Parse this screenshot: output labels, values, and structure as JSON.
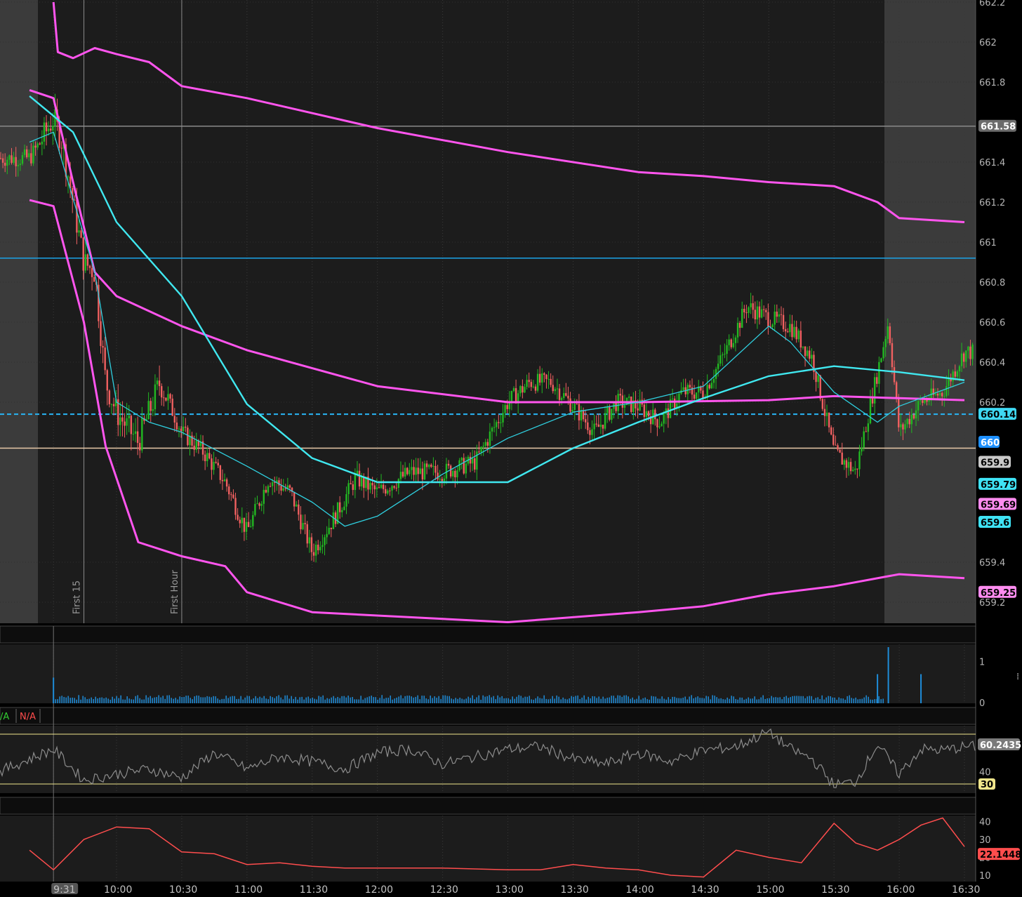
{
  "chart_data": [
    {
      "type": "candlestick",
      "ylim": [
        659.15,
        662.2
      ],
      "y_ticks": [
        "662.2",
        "662",
        "661.8",
        "661.4",
        "661.2",
        "661",
        "660.8",
        "660.6",
        "660.4",
        "660.2",
        "659.4",
        "659.2"
      ],
      "x_ticks": [
        "9:31",
        "10:00",
        "10:30",
        "11:00",
        "11:30",
        "12:00",
        "12:30",
        "13:00",
        "13:30",
        "14:00",
        "14:30",
        "15:00",
        "15:30",
        "16:00",
        "16:30"
      ],
      "marker_lines": [
        {
          "name": "First 15",
          "time": "9:45"
        },
        {
          "name": "First Hour",
          "time": "10:30"
        }
      ],
      "price_badges": [
        {
          "label": "661.58",
          "value": 661.58,
          "bg": "#6b6b6b",
          "fg": "#ffffff"
        },
        {
          "label": "660.14",
          "value": 660.14,
          "bg": "#3fd8f2",
          "fg": "#000000"
        },
        {
          "label": "660",
          "value": 660.0,
          "bg": "#1e90ff",
          "fg": "#ffffff"
        },
        {
          "label": "659.9",
          "value": 659.9,
          "bg": "#c9c9c9",
          "fg": "#000000"
        },
        {
          "label": "659.79",
          "value": 659.79,
          "bg": "#3fe3f5",
          "fg": "#000000"
        },
        {
          "label": "659.69",
          "value": 659.69,
          "bg": "#ff8cf0",
          "fg": "#000000"
        },
        {
          "label": "659.6",
          "value": 659.6,
          "bg": "#3fe3f5",
          "fg": "#000000"
        },
        {
          "label": "659.25",
          "value": 659.25,
          "bg": "#ff8cf0",
          "fg": "#000000"
        }
      ],
      "horizontal_levels": [
        {
          "value": 661.58,
          "color": "#8a8a8a",
          "style": "solid"
        },
        {
          "value": 660.92,
          "color": "#1aa3e8",
          "style": "solid"
        },
        {
          "value": 660.14,
          "color": "#29b6f6",
          "style": "dashed"
        },
        {
          "value": 659.97,
          "color": "#e8c9a8",
          "style": "solid"
        }
      ],
      "series": [
        {
          "role": "vwap_upper_band",
          "color": "#ff55ee",
          "points": [
            [
              "9:31",
              662.2
            ],
            [
              "9:33",
              661.95
            ],
            [
              "9:40",
              661.92
            ],
            [
              "9:50",
              661.97
            ],
            [
              "10:00",
              661.94
            ],
            [
              "10:15",
              661.9
            ],
            [
              "10:30",
              661.78
            ],
            [
              "11:00",
              661.72
            ],
            [
              "12:00",
              661.57
            ],
            [
              "13:00",
              661.45
            ],
            [
              "14:00",
              661.35
            ],
            [
              "14:30",
              661.33
            ],
            [
              "15:00",
              661.3
            ],
            [
              "15:30",
              661.28
            ],
            [
              "15:50",
              661.2
            ],
            [
              "16:00",
              661.12
            ],
            [
              "16:30",
              661.1
            ]
          ]
        },
        {
          "role": "vwap",
          "color": "#ff55ee",
          "points": [
            [
              "9:20",
              661.76
            ],
            [
              "9:31",
              661.72
            ],
            [
              "9:40",
              661.3
            ],
            [
              "9:50",
              660.85
            ],
            [
              "10:00",
              660.73
            ],
            [
              "10:30",
              660.58
            ],
            [
              "11:00",
              660.46
            ],
            [
              "12:00",
              660.28
            ],
            [
              "13:00",
              660.2
            ],
            [
              "14:00",
              660.2
            ],
            [
              "15:00",
              660.21
            ],
            [
              "15:30",
              660.23
            ],
            [
              "16:00",
              660.22
            ],
            [
              "16:30",
              660.21
            ]
          ]
        },
        {
          "role": "vwap_lower_band",
          "color": "#ff55ee",
          "points": [
            [
              "9:20",
              661.21
            ],
            [
              "9:31",
              661.18
            ],
            [
              "9:45",
              660.6
            ],
            [
              "9:55",
              659.98
            ],
            [
              "10:10",
              659.5
            ],
            [
              "10:30",
              659.43
            ],
            [
              "10:50",
              659.38
            ],
            [
              "11:00",
              659.25
            ],
            [
              "11:30",
              659.15
            ],
            [
              "13:00",
              659.1
            ],
            [
              "14:00",
              659.15
            ],
            [
              "14:30",
              659.18
            ],
            [
              "15:00",
              659.24
            ],
            [
              "15:30",
              659.28
            ],
            [
              "16:00",
              659.34
            ],
            [
              "16:30",
              659.32
            ]
          ]
        },
        {
          "role": "ma_slow",
          "color": "#40e8f0",
          "points": [
            [
              "9:20",
              661.73
            ],
            [
              "9:40",
              661.55
            ],
            [
              "10:00",
              661.1
            ],
            [
              "10:30",
              660.73
            ],
            [
              "11:00",
              660.19
            ],
            [
              "11:30",
              659.92
            ],
            [
              "12:00",
              659.8
            ],
            [
              "12:30",
              659.8
            ],
            [
              "13:00",
              659.8
            ],
            [
              "13:30",
              659.97
            ],
            [
              "14:00",
              660.1
            ],
            [
              "14:30",
              660.22
            ],
            [
              "15:00",
              660.33
            ],
            [
              "15:30",
              660.38
            ],
            [
              "16:00",
              660.35
            ],
            [
              "16:30",
              660.31
            ]
          ]
        },
        {
          "role": "ma_fast",
          "color": "#2fd0e0",
          "points": [
            [
              "9:20",
              661.5
            ],
            [
              "9:31",
              661.55
            ],
            [
              "9:50",
              660.85
            ],
            [
              "10:00",
              660.2
            ],
            [
              "10:15",
              660.1
            ],
            [
              "10:30",
              660.05
            ],
            [
              "11:00",
              659.88
            ],
            [
              "11:30",
              659.7
            ],
            [
              "11:45",
              659.58
            ],
            [
              "12:00",
              659.63
            ],
            [
              "12:30",
              659.84
            ],
            [
              "13:00",
              660.02
            ],
            [
              "13:30",
              660.15
            ],
            [
              "14:00",
              660.2
            ],
            [
              "14:30",
              660.28
            ],
            [
              "15:00",
              660.58
            ],
            [
              "15:10",
              660.5
            ],
            [
              "15:30",
              660.25
            ],
            [
              "15:50",
              660.1
            ],
            [
              "16:00",
              660.18
            ],
            [
              "16:30",
              660.3
            ]
          ]
        },
        {
          "role": "price_path",
          "color": "#2bb82b",
          "points": [
            [
              "9:20",
              661.42
            ],
            [
              "9:25",
              661.5
            ],
            [
              "9:31",
              661.62
            ],
            [
              "9:35",
              661.5
            ],
            [
              "9:40",
              661.2
            ],
            [
              "9:45",
              660.9
            ],
            [
              "9:50",
              660.85
            ],
            [
              "9:55",
              660.3
            ],
            [
              "10:00",
              660.15
            ],
            [
              "10:10",
              660.0
            ],
            [
              "10:20",
              660.3
            ],
            [
              "10:30",
              660.05
            ],
            [
              "10:40",
              659.95
            ],
            [
              "10:50",
              659.8
            ],
            [
              "11:00",
              659.55
            ],
            [
              "11:10",
              659.82
            ],
            [
              "11:20",
              659.75
            ],
            [
              "11:30",
              659.45
            ],
            [
              "11:40",
              659.62
            ],
            [
              "11:50",
              659.82
            ],
            [
              "12:00",
              659.75
            ],
            [
              "12:15",
              659.85
            ],
            [
              "12:30",
              659.85
            ],
            [
              "12:45",
              659.9
            ],
            [
              "13:00",
              660.2
            ],
            [
              "13:10",
              660.3
            ],
            [
              "13:20",
              660.3
            ],
            [
              "13:30",
              660.18
            ],
            [
              "13:40",
              660.05
            ],
            [
              "13:50",
              660.2
            ],
            [
              "14:00",
              660.18
            ],
            [
              "14:10",
              660.1
            ],
            [
              "14:20",
              660.25
            ],
            [
              "14:30",
              660.25
            ],
            [
              "14:40",
              660.45
            ],
            [
              "14:50",
              660.68
            ],
            [
              "15:00",
              660.62
            ],
            [
              "15:10",
              660.58
            ],
            [
              "15:20",
              660.42
            ],
            [
              "15:30",
              659.95
            ],
            [
              "15:40",
              659.85
            ],
            [
              "15:50",
              660.35
            ],
            [
              "15:55",
              660.6
            ],
            [
              "16:00",
              660.05
            ],
            [
              "16:10",
              660.2
            ],
            [
              "16:20",
              660.25
            ],
            [
              "16:30",
              660.45
            ]
          ]
        }
      ]
    },
    {
      "type": "bar",
      "name": "volume",
      "y_ticks": [
        "1",
        "0"
      ],
      "bar_color": "#1e8cd8",
      "spikes": [
        {
          "time": "9:31",
          "value": 0.38
        },
        {
          "time": "15:50",
          "value": 0.45
        },
        {
          "time": "15:55",
          "value": 1.0
        },
        {
          "time": "16:10",
          "value": 0.45
        }
      ],
      "baseline_value": 0.12
    },
    {
      "type": "line",
      "name": "RSI",
      "legend": [
        {
          "label": "/A",
          "color": "#32cd32"
        },
        {
          "label": "N/A",
          "color": "#ff4d4d"
        }
      ],
      "y_ticks": [
        "40"
      ],
      "levels": [
        {
          "value": 70,
          "color": "#f0e68c"
        },
        {
          "value": 30,
          "color": "#f0e68c"
        }
      ],
      "last_value_label": "60.2435",
      "level_badge": "30",
      "points": [
        [
          "9:20",
          50
        ],
        [
          "9:31",
          58
        ],
        [
          "9:45",
          33
        ],
        [
          "10:00",
          38
        ],
        [
          "10:15",
          42
        ],
        [
          "10:30",
          35
        ],
        [
          "10:45",
          55
        ],
        [
          "11:00",
          42
        ],
        [
          "11:15",
          52
        ],
        [
          "11:30",
          48
        ],
        [
          "11:45",
          42
        ],
        [
          "12:00",
          55
        ],
        [
          "12:15",
          58
        ],
        [
          "12:30",
          46
        ],
        [
          "12:45",
          52
        ],
        [
          "13:00",
          58
        ],
        [
          "13:15",
          60
        ],
        [
          "13:30",
          50
        ],
        [
          "13:45",
          46
        ],
        [
          "14:00",
          55
        ],
        [
          "14:15",
          48
        ],
        [
          "14:30",
          57
        ],
        [
          "14:45",
          60
        ],
        [
          "15:00",
          72
        ],
        [
          "15:10",
          58
        ],
        [
          "15:20",
          50
        ],
        [
          "15:30",
          29
        ],
        [
          "15:40",
          32
        ],
        [
          "15:50",
          62
        ],
        [
          "16:00",
          38
        ],
        [
          "16:10",
          58
        ],
        [
          "16:20",
          57
        ],
        [
          "16:30",
          60
        ]
      ]
    },
    {
      "type": "line",
      "name": "ADX",
      "y_ticks": [
        "40",
        "30",
        "20",
        "10"
      ],
      "last_value_label": "22.1448",
      "color": "#ff4d4d",
      "points": [
        [
          "9:20",
          24
        ],
        [
          "9:31",
          13
        ],
        [
          "9:45",
          30
        ],
        [
          "10:00",
          37
        ],
        [
          "10:15",
          36
        ],
        [
          "10:30",
          23
        ],
        [
          "10:45",
          22
        ],
        [
          "11:00",
          16
        ],
        [
          "11:15",
          17
        ],
        [
          "11:30",
          15
        ],
        [
          "11:45",
          14
        ],
        [
          "12:00",
          14
        ],
        [
          "12:30",
          14
        ],
        [
          "13:00",
          13
        ],
        [
          "13:15",
          13
        ],
        [
          "13:30",
          16
        ],
        [
          "13:45",
          14
        ],
        [
          "14:00",
          13
        ],
        [
          "14:15",
          10
        ],
        [
          "14:30",
          9
        ],
        [
          "14:45",
          24
        ],
        [
          "15:00",
          20
        ],
        [
          "15:15",
          17
        ],
        [
          "15:30",
          39
        ],
        [
          "15:40",
          28
        ],
        [
          "15:50",
          24
        ],
        [
          "16:00",
          30
        ],
        [
          "16:10",
          38
        ],
        [
          "16:20",
          42
        ],
        [
          "16:30",
          26
        ]
      ]
    }
  ]
}
